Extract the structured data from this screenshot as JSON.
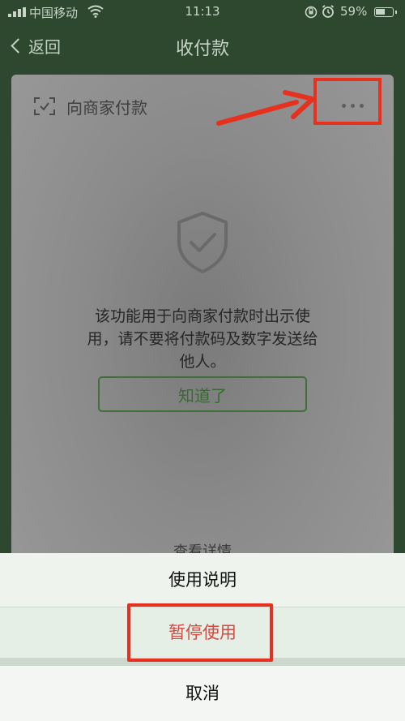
{
  "status_bar": {
    "carrier": "中国移动",
    "time": "11:13",
    "battery": "59%"
  },
  "nav": {
    "back_label": "返回",
    "title": "收付款"
  },
  "card": {
    "title": "向商家付款",
    "notice": "该功能用于向商家付款时出示使用，请不要将付款码及数字发送给他人。",
    "ok_label": "知道了",
    "details_label": "查看详情"
  },
  "action_sheet": {
    "items": [
      {
        "label": "使用说明"
      },
      {
        "label": "暂停使用",
        "color": "#d24a42"
      }
    ],
    "cancel_label": "取消"
  },
  "colors": {
    "header_green": "#2d482f",
    "annotation_red": "#e8301f",
    "accent_green": "#3a6a34"
  }
}
